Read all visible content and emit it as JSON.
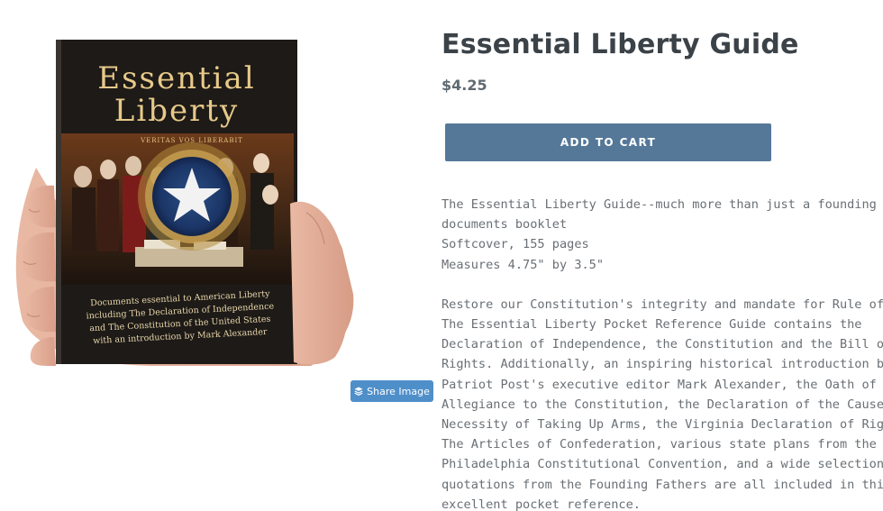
{
  "product": {
    "title": "Essential Liberty Guide",
    "price": "$4.25",
    "add_to_cart_label": "ADD TO CART",
    "share_image_label": "Share Image",
    "book_cover": {
      "title_line1": "Essential",
      "title_line2": "Liberty",
      "seal_text": "VERITAS VOS LIBERABIT",
      "subtitle_lines": [
        "Documents essential to American Liberty",
        "including The Declaration of Independence",
        "and The Constitution of the United States",
        "with an introduction by Mark Alexander"
      ]
    },
    "description": {
      "summary_lines": [
        "The Essential Liberty Guide--much more than just a founding",
        "documents booklet",
        "Softcover, 155 pages",
        "Measures 4.75\" by 3.5\""
      ],
      "body_lines": [
        "Restore our Constitution's integrity and mandate for Rule of Law!",
        "The Essential Liberty Pocket Reference Guide contains the",
        "Declaration of Independence, the Constitution and the Bill of",
        "Rights. Additionally, an inspiring historical introduction by the",
        "Patriot Post's executive editor Mark Alexander, the Oath of",
        "Allegiance to the Constitution, the Declaration of the Cause and",
        "Necessity of Taking Up Arms, the Virginia Declaration of Rights,",
        "The Articles of Confederation, various state plans from the",
        "Philadelphia Constitutional Convention, and a wide selection of",
        "quotations from the Founding Fathers are all included in this",
        "excellent pocket reference."
      ]
    }
  },
  "colors": {
    "cart_button": "#557899",
    "share_button": "#4f8fc9",
    "title": "#3b4248",
    "body_text": "#6a6f74"
  }
}
